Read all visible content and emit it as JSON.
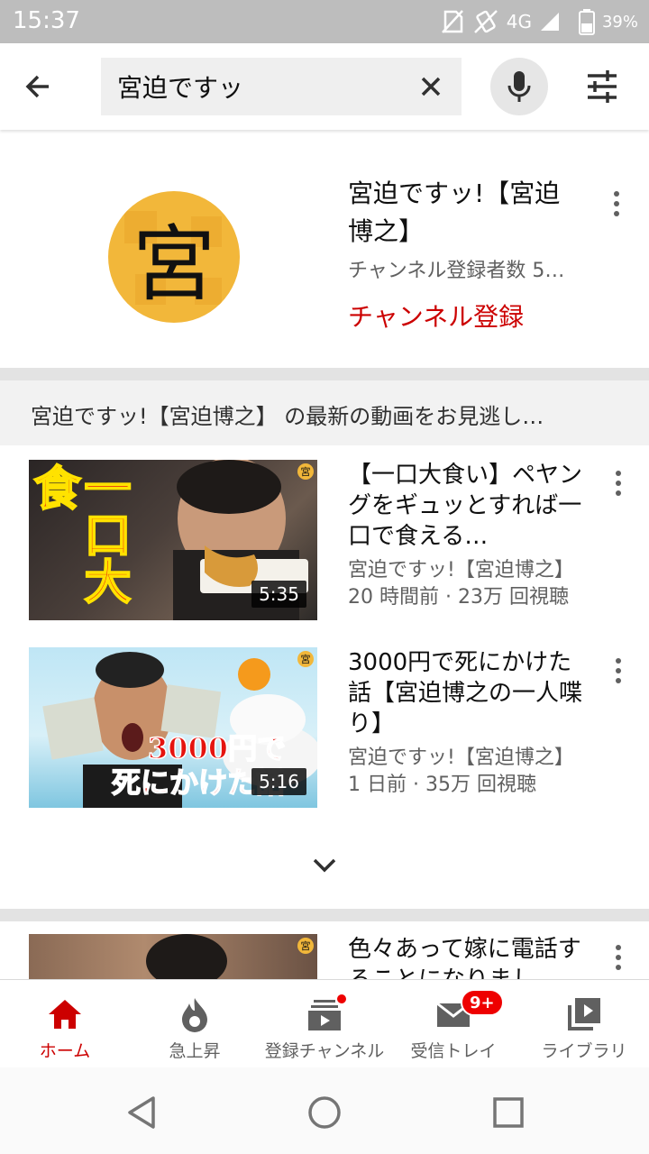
{
  "status_bar": {
    "time": "15:37",
    "network": "4G",
    "battery": "39%"
  },
  "search": {
    "query": "宮迫ですッ",
    "icons": [
      "back-arrow-icon",
      "clear-icon",
      "mic-icon",
      "filter-icon"
    ]
  },
  "channel": {
    "avatar_glyph": "宮",
    "name": "宮迫ですッ!【宮迫博之】",
    "subscribers": "チャンネル登録者数 5…",
    "subscribe_label": "チャンネル登録"
  },
  "section": {
    "header": "宮迫ですッ!【宮迫博之】 の最新の動画をお見逃し…"
  },
  "videos": [
    {
      "title": "【一口大食い】ペヤングをギュッとすれば一口で食える…",
      "channel": "宮迫ですッ!【宮迫博之】",
      "meta": "20 時間前 · 23万 回視聴",
      "duration": "5:35",
      "thumb_text": "一口大食",
      "thumb_badge": "宮"
    },
    {
      "title": "3000円で死にかけた話【宮迫博之の一人喋り】",
      "channel": "宮迫ですッ!【宮迫博之】",
      "meta": "1 日前 · 35万 回視聴",
      "duration": "5:16",
      "thumb_text_1": "3000円で",
      "thumb_text_2": "死にかけた話",
      "thumb_badge": "宮"
    },
    {
      "title": "色々あって嫁に電話することになりまし…",
      "thumb_badge": "宮"
    }
  ],
  "bottom_nav": [
    {
      "label": "ホーム",
      "icon": "home-icon",
      "active": true
    },
    {
      "label": "急上昇",
      "icon": "flame-icon",
      "active": false
    },
    {
      "label": "登録チャンネル",
      "icon": "subscriptions-icon",
      "active": false
    },
    {
      "label": "受信トレイ",
      "icon": "mail-icon",
      "active": false,
      "badge": "9+"
    },
    {
      "label": "ライブラリ",
      "icon": "library-icon",
      "active": false
    }
  ],
  "colors": {
    "accent": "#cc0000",
    "badge": "#ee0000",
    "avatar": "#f2b73a"
  }
}
